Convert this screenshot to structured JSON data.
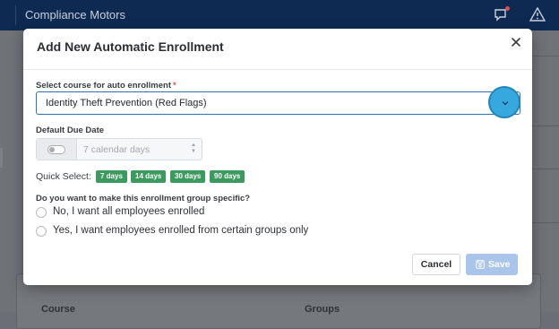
{
  "app": {
    "title": "Compliance Motors"
  },
  "background": {
    "table_headers": [
      "Course",
      "Groups"
    ]
  },
  "modal": {
    "title": "Add New Automatic Enrollment",
    "course_label": "Select course for auto enrollment",
    "required_mark": "*",
    "course_selected": "Identity Theft Prevention (Red Flags)",
    "due_date_label": "Default Due Date",
    "due_date_placeholder": "7 calendar days",
    "quick_select_label": "Quick Select:",
    "quick_select_options": [
      "7 days",
      "14 days",
      "30 days",
      "90 days"
    ],
    "group_question": "Do you want to make this enrollment group specific?",
    "radio_options": [
      "No, I want all employees enrolled",
      "Yes, I want employees enrolled from certain groups only"
    ],
    "cancel_label": "Cancel",
    "save_label": "Save"
  },
  "icons": {
    "close": "close-icon",
    "caret": "chevron-down-icon",
    "save": "floppy-disk-icon",
    "feedback": "megaphone-icon",
    "alert": "warning-icon"
  },
  "colors": {
    "topbar": "#0e2a52",
    "chip": "#3c9a5f",
    "save_disabled": "#a9c5ea",
    "select_border": "#2f72b8",
    "required": "#d9534f"
  }
}
